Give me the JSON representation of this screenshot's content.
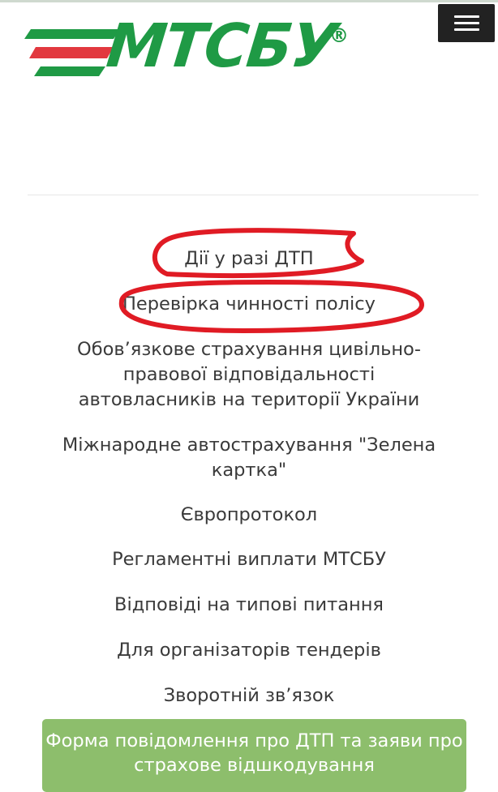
{
  "header": {
    "logo_text": "МТСБУ",
    "logo_reg": "®",
    "brand_colors": {
      "green": "#1f9a45",
      "red": "#e2383f"
    },
    "menu_icon": "hamburger-icon"
  },
  "nav": {
    "items": [
      {
        "label": "Дії у разі ДТП",
        "highlighted": true
      },
      {
        "label": "Перевірка чинності полісу",
        "highlighted": true
      },
      {
        "label": "Обов’язкове страхування цивільно-правової відповідальності автовласників на території України"
      },
      {
        "label": "Міжнародне автострахування \"Зелена картка\""
      },
      {
        "label": "Європротокол"
      },
      {
        "label": "Регламентні виплати МТСБУ"
      },
      {
        "label": "Відповіді на типові питання"
      },
      {
        "label": "Для організаторів тендерів"
      },
      {
        "label": "Зворотній зв’язок"
      }
    ],
    "highlight_color": "#e01b24"
  },
  "cta": {
    "label": "Форма повідомлення про ДТП та заяви про страхове відшкодування",
    "color": "#8dbe6c"
  }
}
